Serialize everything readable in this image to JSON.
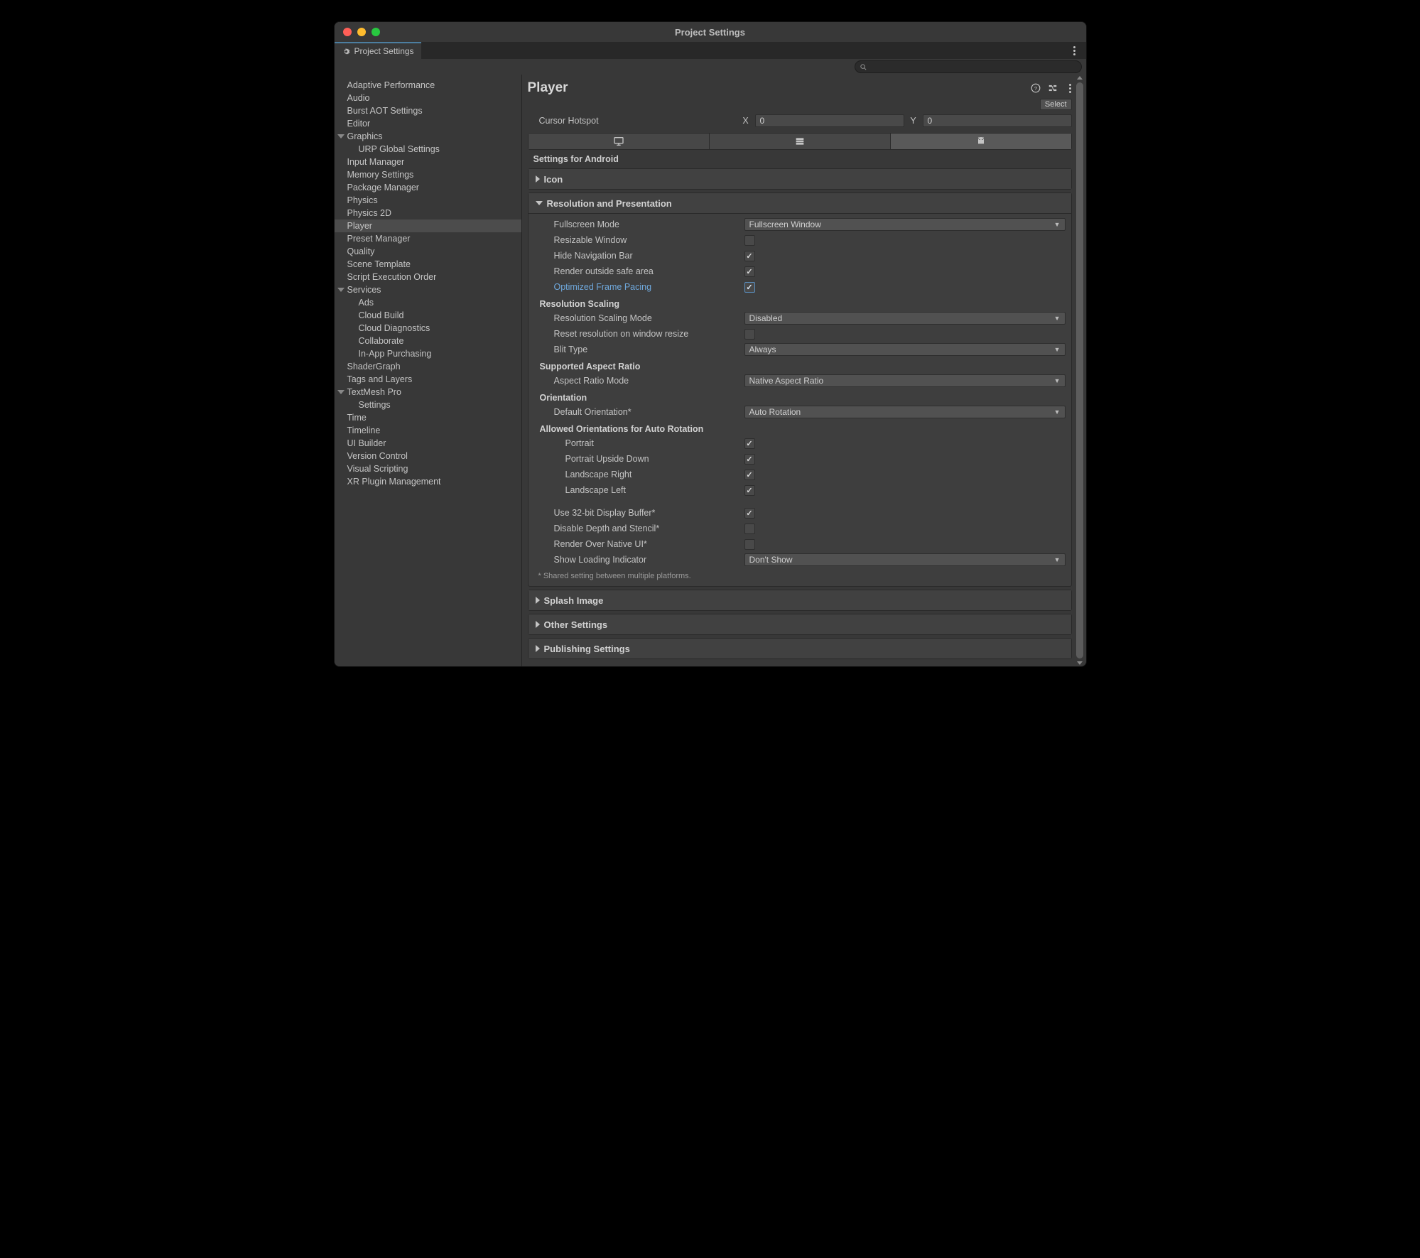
{
  "window_title": "Project Settings",
  "tab_label": "Project Settings",
  "search_placeholder": "",
  "sidebar": {
    "items": [
      {
        "label": "Adaptive Performance",
        "indent": 0
      },
      {
        "label": "Audio",
        "indent": 0
      },
      {
        "label": "Burst AOT Settings",
        "indent": 0
      },
      {
        "label": "Editor",
        "indent": 0
      },
      {
        "label": "Graphics",
        "indent": 0,
        "arrow": "down"
      },
      {
        "label": "URP Global Settings",
        "indent": 1
      },
      {
        "label": "Input Manager",
        "indent": 0
      },
      {
        "label": "Memory Settings",
        "indent": 0
      },
      {
        "label": "Package Manager",
        "indent": 0
      },
      {
        "label": "Physics",
        "indent": 0
      },
      {
        "label": "Physics 2D",
        "indent": 0
      },
      {
        "label": "Player",
        "indent": 0,
        "selected": true
      },
      {
        "label": "Preset Manager",
        "indent": 0
      },
      {
        "label": "Quality",
        "indent": 0
      },
      {
        "label": "Scene Template",
        "indent": 0
      },
      {
        "label": "Script Execution Order",
        "indent": 0
      },
      {
        "label": "Services",
        "indent": 0,
        "arrow": "down"
      },
      {
        "label": "Ads",
        "indent": 1
      },
      {
        "label": "Cloud Build",
        "indent": 1
      },
      {
        "label": "Cloud Diagnostics",
        "indent": 1
      },
      {
        "label": "Collaborate",
        "indent": 1
      },
      {
        "label": "In-App Purchasing",
        "indent": 1
      },
      {
        "label": "ShaderGraph",
        "indent": 0
      },
      {
        "label": "Tags and Layers",
        "indent": 0
      },
      {
        "label": "TextMesh Pro",
        "indent": 0,
        "arrow": "down"
      },
      {
        "label": "Settings",
        "indent": 1
      },
      {
        "label": "Time",
        "indent": 0
      },
      {
        "label": "Timeline",
        "indent": 0
      },
      {
        "label": "UI Builder",
        "indent": 0
      },
      {
        "label": "Version Control",
        "indent": 0
      },
      {
        "label": "Visual Scripting",
        "indent": 0
      },
      {
        "label": "XR Plugin Management",
        "indent": 0
      }
    ]
  },
  "main": {
    "title": "Player",
    "select_label": "Select",
    "cursor_hotspot": {
      "label": "Cursor Hotspot",
      "x_label": "X",
      "x_value": "0",
      "y_label": "Y",
      "y_value": "0"
    },
    "platform_section_label": "Settings for Android",
    "sections": {
      "icon": "Icon",
      "resolution": "Resolution and Presentation",
      "splash": "Splash Image",
      "other": "Other Settings",
      "publishing": "Publishing Settings"
    },
    "res": {
      "fullscreen_mode": {
        "label": "Fullscreen Mode",
        "value": "Fullscreen Window"
      },
      "resizable_window": {
        "label": "Resizable Window",
        "checked": false
      },
      "hide_nav": {
        "label": "Hide Navigation Bar",
        "checked": true
      },
      "render_outside": {
        "label": "Render outside safe area",
        "checked": true
      },
      "optimized_frame_pacing": {
        "label": "Optimized Frame Pacing",
        "checked": true
      },
      "sub_scaling": "Resolution Scaling",
      "scaling_mode": {
        "label": "Resolution Scaling Mode",
        "value": "Disabled"
      },
      "reset_res": {
        "label": "Reset resolution on window resize",
        "checked": false
      },
      "blit_type": {
        "label": "Blit Type",
        "value": "Always"
      },
      "sub_aspect": "Supported Aspect Ratio",
      "aspect_mode": {
        "label": "Aspect Ratio Mode",
        "value": "Native Aspect Ratio"
      },
      "sub_orientation": "Orientation",
      "default_orientation": {
        "label": "Default Orientation*",
        "value": "Auto Rotation"
      },
      "sub_allowed": "Allowed Orientations for Auto Rotation",
      "portrait": {
        "label": "Portrait",
        "checked": true
      },
      "portrait_upside": {
        "label": "Portrait Upside Down",
        "checked": true
      },
      "landscape_right": {
        "label": "Landscape Right",
        "checked": true
      },
      "landscape_left": {
        "label": "Landscape Left",
        "checked": true
      },
      "use_32bit": {
        "label": "Use 32-bit Display Buffer*",
        "checked": true
      },
      "disable_depth": {
        "label": "Disable Depth and Stencil*",
        "checked": false
      },
      "render_over_native": {
        "label": "Render Over Native UI*",
        "checked": false
      },
      "show_loading": {
        "label": "Show Loading Indicator",
        "value": "Don't Show"
      },
      "footnote": "* Shared setting between multiple platforms."
    }
  }
}
